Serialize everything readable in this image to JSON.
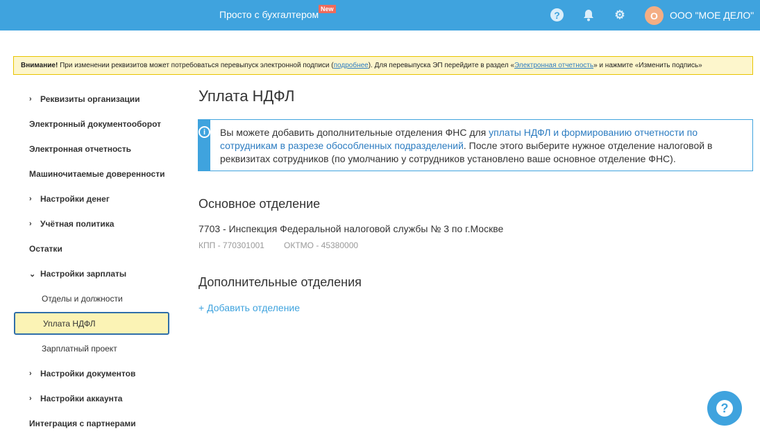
{
  "header": {
    "brand": "Просто с бухгалтером",
    "new_badge": "New",
    "avatar_letter": "О",
    "org_name": "ООО \"МОЕ ДЕЛО\""
  },
  "warning": {
    "bold": "Внимание!",
    "text1": " При изменении реквизитов может потребоваться перевыпуск электронной подписи (",
    "link1": "подробнее",
    "text2": "). Для перевыпуска ЭП перейдите в раздел «",
    "link2": "Электронная отчетность",
    "text3": "» и нажмите «Изменить подпись»"
  },
  "sidebar": {
    "items": [
      {
        "label": "Реквизиты организации",
        "chevron": "›"
      },
      {
        "label": "Электронный документооборот"
      },
      {
        "label": "Электронная отчетность"
      },
      {
        "label": "Машиночитаемые доверенности"
      },
      {
        "label": "Настройки денег",
        "chevron": "›"
      },
      {
        "label": "Учётная политика",
        "chevron": "›"
      },
      {
        "label": "Остатки"
      },
      {
        "label": "Настройки зарплаты",
        "chevron": "⌄"
      },
      {
        "label": "Отделы и должности"
      },
      {
        "label": "Уплата НДФЛ"
      },
      {
        "label": "Зарплатный проект"
      },
      {
        "label": "Настройки документов",
        "chevron": "›"
      },
      {
        "label": "Настройки аккаунта",
        "chevron": "›"
      },
      {
        "label": "Интеграция с партнерами"
      }
    ]
  },
  "main": {
    "title": "Уплата НДФЛ",
    "info": {
      "t1": "Вы можете добавить дополнительные отделения ФНС для ",
      "link": "уплаты НДФЛ и формированию отчетности по сотрудникам в разрезе обособленных подразделений",
      "t2": ". После этого выберите нужное отделение налоговой в реквизитах сотрудников (по умолчанию у сотрудников установлено ваше основное отделение ФНС)."
    },
    "main_section": "Основное отделение",
    "main_office": "7703 - Инспекция Федеральной налоговой службы № 3 по г.Москве",
    "kpp": "КПП - 770301001",
    "oktmo": "ОКТМО - 45380000",
    "extra_section": "Дополнительные отделения",
    "add_label": "+ Добавить отделение"
  }
}
